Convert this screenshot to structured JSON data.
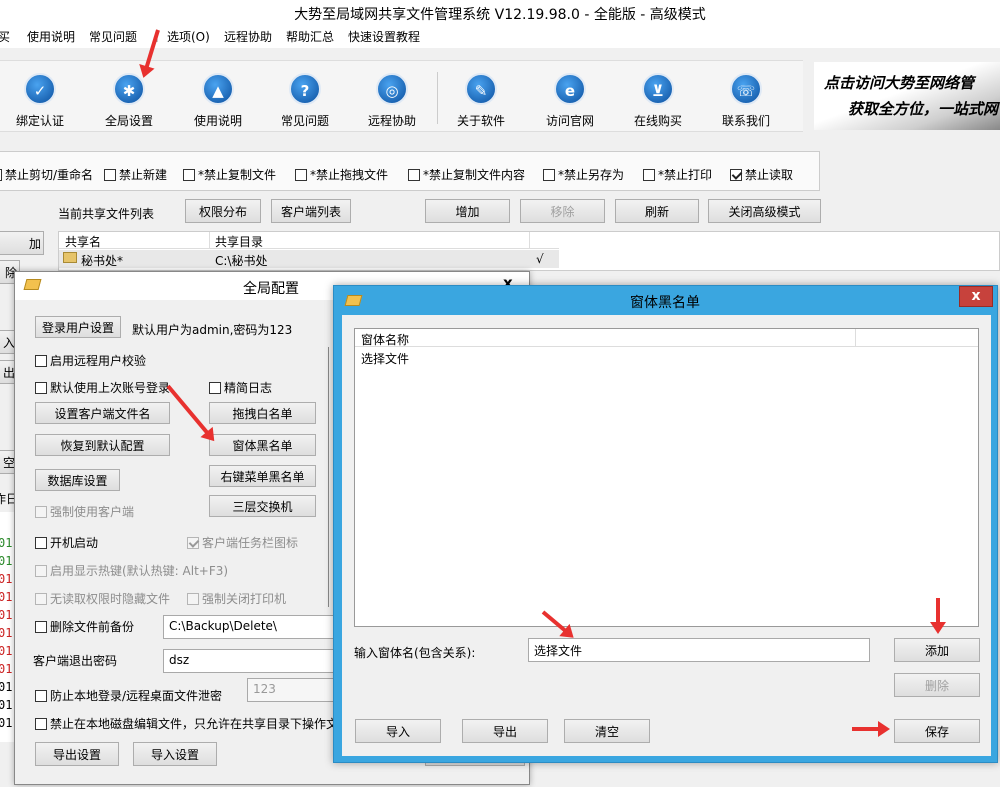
{
  "title": "大势至局域网共享文件管理系统 V12.19.98.0 - 全能版 - 高级模式",
  "menu": [
    "买",
    "使用说明",
    "常见问题",
    "|",
    "选项(O)",
    "远程协助",
    "帮助汇总",
    "快速设置教程"
  ],
  "toolbar": [
    "绑定认证",
    "全局设置",
    "使用说明",
    "常见问题",
    "远程协助",
    "关于软件",
    "访问官网",
    "在线购买",
    "联系我们"
  ],
  "toolbar_icons": [
    "shield-icon",
    "gear-icon",
    "book-icon",
    "question-icon",
    "globe-icon",
    "info-icon",
    "ie-icon",
    "cart-icon",
    "phone-icon"
  ],
  "banner": {
    "line1": "点击访问大势至网络管",
    "line2": "获取全方位，一站式网"
  },
  "restrictions": [
    {
      "label": "禁止剪切/重命名",
      "checked": false
    },
    {
      "label": "禁止新建",
      "checked": false
    },
    {
      "label": "*禁止复制文件",
      "checked": false
    },
    {
      "label": "*禁止拖拽文件",
      "checked": false
    },
    {
      "label": "*禁止复制文件内容",
      "checked": false
    },
    {
      "label": "*禁止另存为",
      "checked": false
    },
    {
      "label": "*禁止打印",
      "checked": false
    },
    {
      "label": "禁止读取",
      "checked": true
    }
  ],
  "share": {
    "list_label": "当前共享文件列表",
    "perm_btn": "权限分布",
    "client_btn": "客户端列表",
    "add_btn": "增加",
    "remove_btn": "移除",
    "refresh_btn": "刷新",
    "close_adv_btn": "关闭高级模式",
    "col_name": "共享名",
    "col_dir": "共享目录",
    "row_name": "秘书处*",
    "row_dir": "C:\\秘书处",
    "row_mark": "√"
  },
  "left_stubs": [
    "加",
    "除",
    "入",
    "出",
    "空",
    "作日"
  ],
  "log_prefix": "01",
  "global": {
    "title": "全局配置",
    "close": "x",
    "login_btn": "登录用户设置",
    "login_hint": "默认用户为admin,密码为123",
    "remote_verify": "启用远程用户校验",
    "last_account": "默认使用上次账号登录",
    "simple_log": "精简日志",
    "set_client_name": "设置客户端文件名",
    "drag_whitelist": "拖拽白名单",
    "restore_default": "恢复到默认配置",
    "window_blacklist": "窗体黑名单",
    "rclick_blacklist": "右键菜单黑名单",
    "db_settings": "数据库设置",
    "three_layer": "三层交换机",
    "force_client": "强制使用客户端",
    "autostart": "开机启动",
    "tray_icon": "客户端任务栏图标",
    "hotkey": "启用显示热键(默认热键: Alt+F3)",
    "hide_no_perm": "无读取权限时隐藏文件",
    "force_close_printer": "强制关闭打印机",
    "backup_before_delete": "删除文件前备份",
    "backup_path": "C:\\Backup\\Delete\\",
    "exit_pwd_label": "客户端退出密码",
    "exit_pwd": "dsz",
    "prevent_leak": "防止本地登录/远程桌面文件泄密",
    "leak_pwd": "123",
    "disk_edit": "禁止在本地磁盘编辑文件，只允许在共享目录下操作文",
    "export_btn": "导出设置",
    "import_btn": "导入设置"
  },
  "blacklist": {
    "title": "窗体黑名单",
    "close": "x",
    "col": "窗体名称",
    "items": [
      "选择文件"
    ],
    "input_label": "输入窗体名(包含关系):",
    "input_value": "选择文件",
    "add": "添加",
    "delete": "删除",
    "import": "导入",
    "export": "导出",
    "clear": "清空",
    "save": "保存"
  },
  "colors": {
    "accent": "#3aa6e0",
    "arrow": "#e8312f"
  }
}
